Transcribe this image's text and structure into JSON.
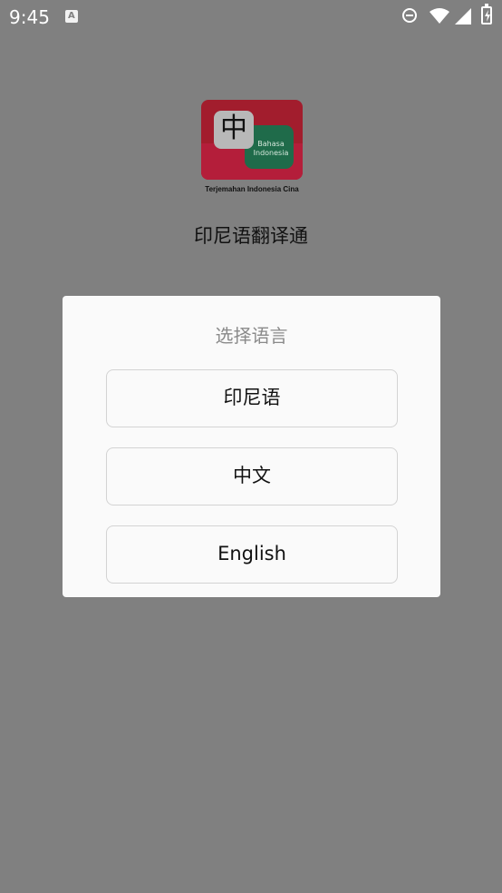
{
  "status_bar": {
    "time": "9:45",
    "notification_icon": "text-a-icon",
    "notification_glyph": "A",
    "icons": [
      "do-not-disturb-icon",
      "wifi-icon",
      "signal-icon",
      "battery-charging-icon"
    ]
  },
  "app": {
    "logo": {
      "glyph": "中",
      "badge_line1": "Bahasa",
      "badge_line2": "Indonesia",
      "caption": "Terjemahan Indonesia Cina"
    },
    "title": "印尼语翻译通"
  },
  "dialog": {
    "title": "选择语言",
    "options": [
      {
        "label": "印尼语"
      },
      {
        "label": "中文"
      },
      {
        "label": "English"
      }
    ]
  },
  "colors": {
    "scrim": "#808080",
    "dialog_bg": "#fafafa",
    "logo_red": "#a21d2d",
    "logo_green": "#1f6b4a"
  }
}
